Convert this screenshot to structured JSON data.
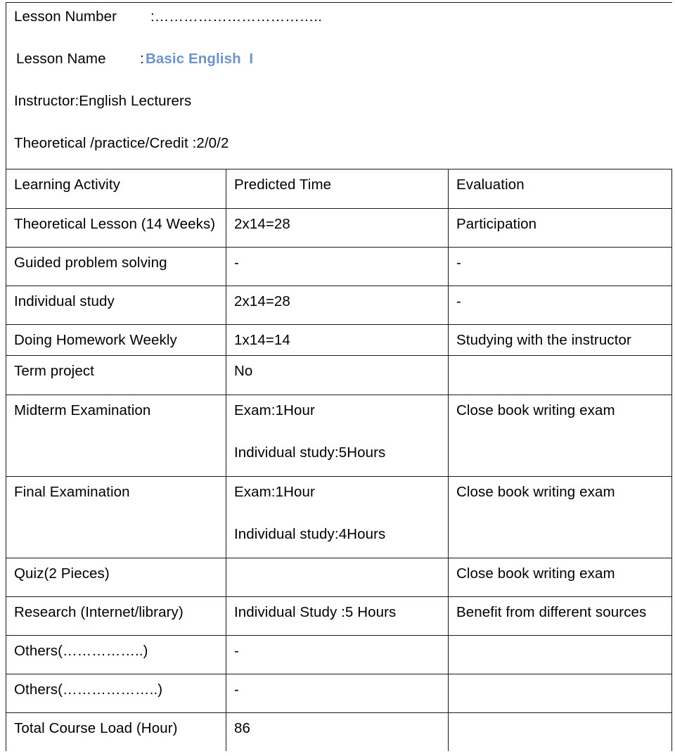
{
  "document": {
    "header": {
      "lesson_number_label": "Lesson Number",
      "lesson_number_value": ":……………………………..",
      "lesson_name_label": "Lesson Name",
      "lesson_name_colon": ":",
      "lesson_name_value": "Basic English  I",
      "lesson_name_color": "#6e93c6",
      "instructor": "Instructor:English Lecturers",
      "credit": "Theoretical /practice/Credit :2/0/2"
    },
    "table": {
      "columns": [
        "Learning Activity",
        "Predicted Time",
        "Evaluation"
      ],
      "rows": [
        {
          "activity": "Theoretical Lesson (14 Weeks)",
          "time": "2x14=28",
          "time_line2": "",
          "evaluation": "Participation"
        },
        {
          "activity": "Guided problem solving",
          "time": "-",
          "time_line2": "",
          "evaluation": "-"
        },
        {
          "activity": "Individual study",
          "time": "2x14=28",
          "time_line2": "",
          "evaluation": "-"
        },
        {
          "activity": "Doing Homework Weekly",
          "time": "1x14=14",
          "time_line2": "",
          "evaluation": "Studying with the instructor"
        },
        {
          "activity": "Term project",
          "time": "No",
          "time_line2": "",
          "evaluation": ""
        },
        {
          "activity": "Midterm Examination",
          "time": "Exam:1Hour",
          "time_line2": "Individual study:5Hours",
          "evaluation": "Close book writing exam"
        },
        {
          "activity": "Final Examination",
          "time": "Exam:1Hour",
          "time_line2": "Individual study:4Hours",
          "evaluation": "Close book writing exam"
        },
        {
          "activity": "Quiz(2 Pieces)",
          "time": "",
          "time_line2": "",
          "evaluation": "Close book writing exam"
        },
        {
          "activity": "Research (Internet/library)",
          "time": "Individual Study :5 Hours",
          "time_line2": "",
          "evaluation": "Benefit from different sources"
        },
        {
          "activity": "Others(……………..)",
          "time": "-",
          "time_line2": "",
          "evaluation": ""
        },
        {
          "activity": "Others(………………..)",
          "time": "-",
          "time_line2": "",
          "evaluation": ""
        },
        {
          "activity": "Total Course Load (Hour)",
          "time": "86",
          "time_line2": "",
          "evaluation": ""
        }
      ]
    }
  }
}
